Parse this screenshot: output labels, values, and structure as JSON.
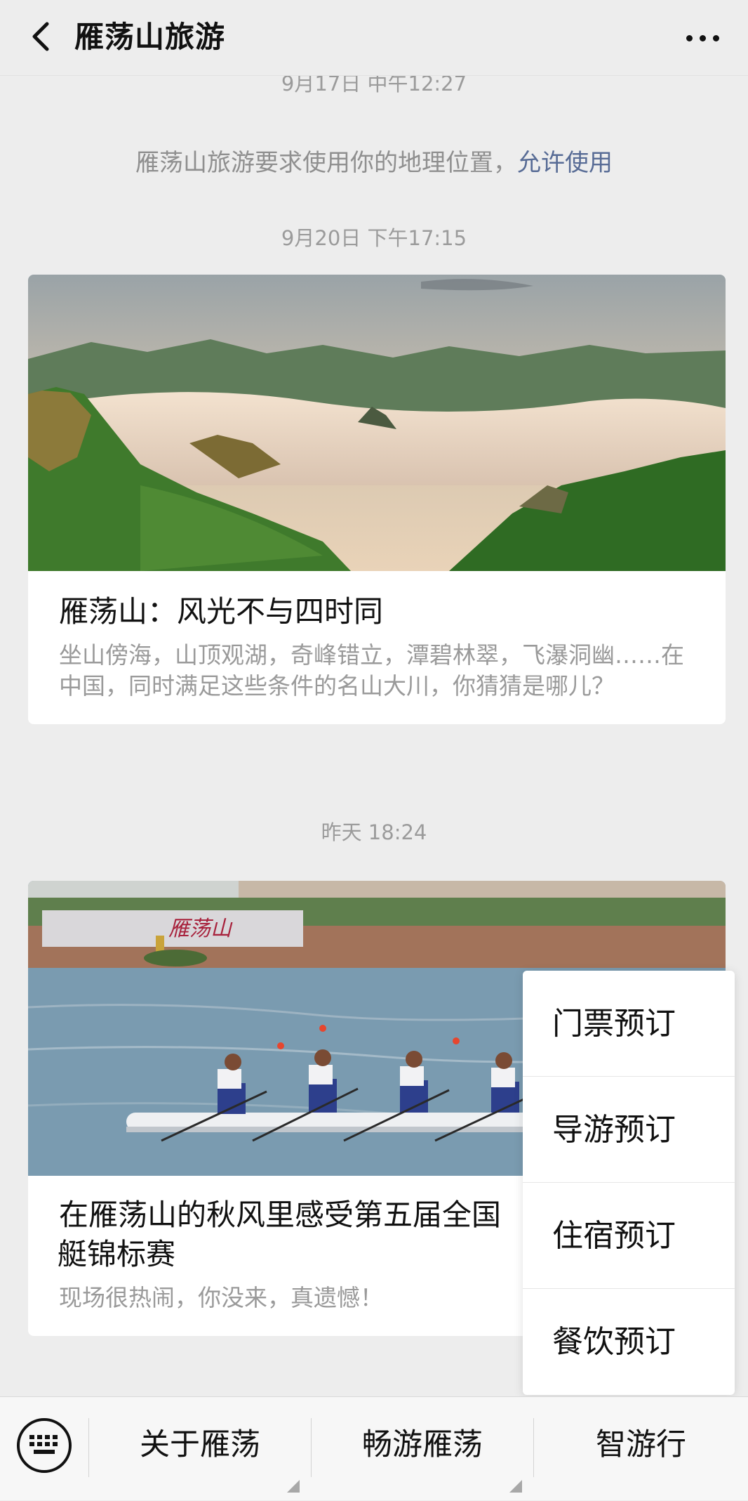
{
  "header": {
    "title": "雁荡山旅游"
  },
  "feed": {
    "partial_time": "9月17日 中午12:27",
    "system_message": {
      "text": "雁荡山旅游要求使用你的地理位置，",
      "link": "允许使用"
    },
    "time_2": "9月20日 下午17:15",
    "card_1": {
      "title": "雁荡山：风光不与四时同",
      "desc": "坐山傍海，山顶观湖，奇峰错立，潭碧林翠，飞瀑洞幽……在中国，同时满足这些条件的名山大川，你猜猜是哪儿？"
    },
    "time_3": "昨天 18:24",
    "card_2": {
      "title": "在雁荡山的秋风里感受第五届全国​赛艇锦标赛",
      "title_line1": "在雁荡山的秋风里感受第五届全国",
      "title_line2": "艇锦标赛",
      "desc": "现场很热闹，你没来，真遗憾！",
      "banner_text": "雁荡山"
    }
  },
  "popup_menu": [
    "门票预订",
    "导游预订",
    "住宿预订",
    "餐饮预订"
  ],
  "bottom_bar": {
    "menus": [
      "关于雁荡",
      "畅游雁荡",
      "智游行"
    ]
  }
}
